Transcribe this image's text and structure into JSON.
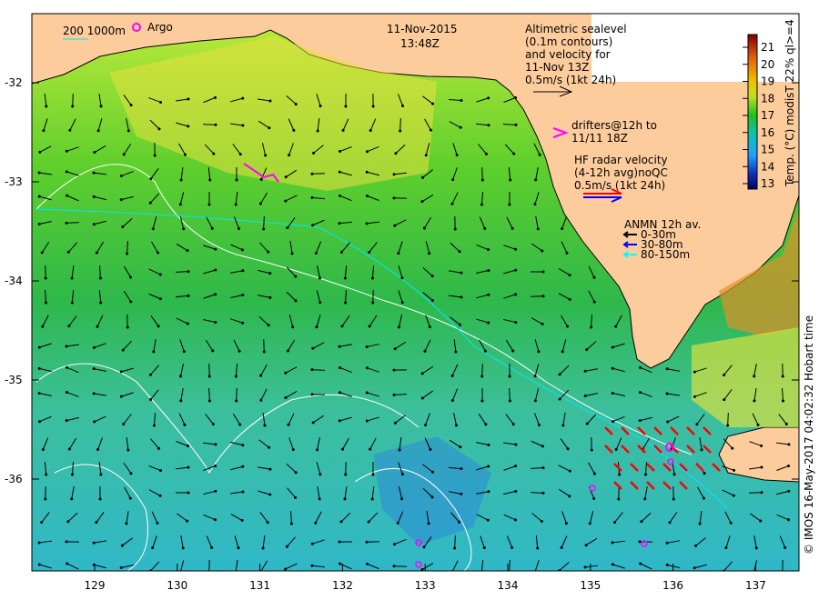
{
  "title": {
    "date": "11-Nov-2015",
    "time": "13:48Z"
  },
  "scale_legend": {
    "depth_labels": "200  1000m",
    "argo_label": "Argo",
    "argo_color": "#ff00ff",
    "contour_color": "#00e5ff"
  },
  "altimetry_legend": {
    "lines": [
      "Altimetric sealevel",
      "(0.1m contours)",
      "and velocity for",
      "11-Nov 13Z",
      "0.5m/s (1kt 24h)"
    ]
  },
  "drifters_legend": {
    "lines": [
      "drifters@12h to",
      "11/11 18Z"
    ],
    "color": "#ff00ff"
  },
  "hf_radar_legend": {
    "lines": [
      "HF radar velocity",
      "(4-12h avg)noQC",
      "0.5m/s (1kt 24h)"
    ],
    "colors": [
      "#ff0000",
      "#0000ff"
    ]
  },
  "anmn_legend": {
    "title": "ANMN 12h av.",
    "items": [
      {
        "label": "0-30m",
        "color": "#000000"
      },
      {
        "label": "30-80m",
        "color": "#0000ff"
      },
      {
        "label": "80-150m",
        "color": "#00ffff"
      }
    ]
  },
  "colorbar": {
    "label": "Temp. (°C) modisT 22% ql>=4",
    "ticks": [
      "21",
      "20",
      "19",
      "18",
      "17",
      "16",
      "15",
      "14",
      "13"
    ],
    "range": [
      13,
      21.5
    ]
  },
  "axes": {
    "lon_ticks": [
      "129",
      "130",
      "131",
      "132",
      "133",
      "134",
      "135",
      "136",
      "137"
    ],
    "lat_ticks": [
      "-32",
      "-33",
      "-34",
      "-35",
      "-36"
    ]
  },
  "credit": "© IMOS 16-May-2017 04:02:32 Hobart time",
  "colors": {
    "land": "#fdcc9c",
    "ocean_north": "#7fd43a",
    "ocean_south": "#2cc0b0"
  }
}
